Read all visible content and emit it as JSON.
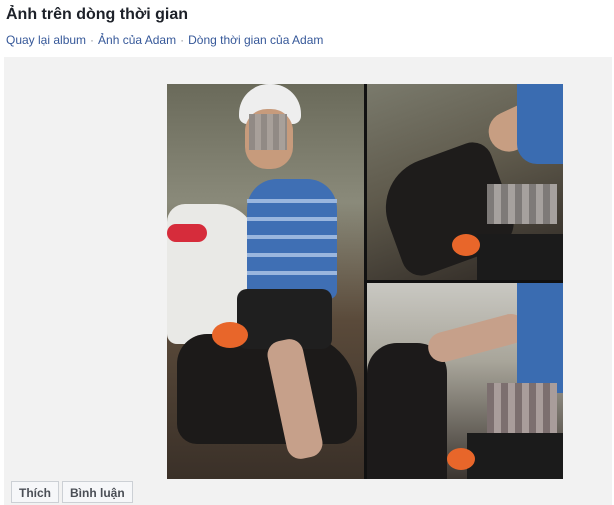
{
  "header": {
    "title": "Ảnh trên dòng thời gian"
  },
  "breadcrumb": {
    "items": [
      "Quay lại album",
      "Ảnh của Adam",
      "Dòng thời gian của Adam"
    ],
    "separator": "·"
  },
  "actions": {
    "like_label": "Thích",
    "comment_label": "Bình luận"
  },
  "colors": {
    "link": "#365899",
    "title": "#1d2129",
    "stage_background": "#f2f2f2"
  }
}
